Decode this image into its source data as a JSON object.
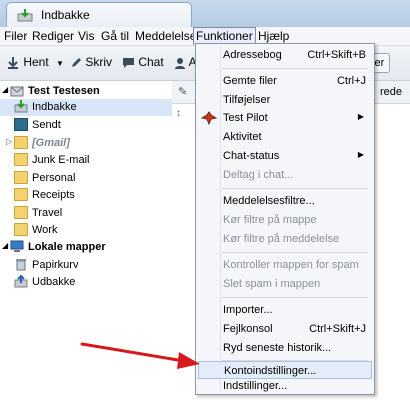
{
  "window": {
    "tab_title": "Indbakke"
  },
  "menubar": [
    "Filer",
    "Rediger",
    "Vis",
    "Gå til",
    "Meddelelse",
    "Funktioner",
    "Hjælp"
  ],
  "toolbar": {
    "get": "Hent",
    "write": "Skriv",
    "chat": "Chat",
    "partial": "A",
    "filter": "lter",
    "quick_filter_hint": "rede"
  },
  "folders": {
    "account1": "Test Testesen",
    "inbox": "Indbakke",
    "sent": "Sendt",
    "gmail": "[Gmail]",
    "junk": "Junk E-mail",
    "personal": "Personal",
    "receipts": "Receipts",
    "travel": "Travel",
    "work": "Work",
    "local": "Lokale mapper",
    "trash": "Papirkurv",
    "outbox": "Udbakke"
  },
  "menu": {
    "addressbook": {
      "label": "Adressebog",
      "shortcut": "Ctrl+Skift+B"
    },
    "saved_files": {
      "label": "Gemte filer",
      "shortcut": "Ctrl+J"
    },
    "addons": {
      "label": "Tilføjelser"
    },
    "test_pilot": {
      "label": "Test Pilot"
    },
    "activity": {
      "label": "Aktivitet"
    },
    "chat_status": {
      "label": "Chat-status"
    },
    "join_chat": {
      "label": "Deltag i chat..."
    },
    "message_filters": {
      "label": "Meddelelsesfiltre..."
    },
    "run_filters_folder": {
      "label": "Kør filtre på mappe"
    },
    "run_filters_message": {
      "label": "Kør filtre på meddelelse"
    },
    "check_spam": {
      "label": "Kontroller mappen for spam"
    },
    "delete_spam": {
      "label": "Slet spam i mappen"
    },
    "import": {
      "label": "Importer..."
    },
    "error_console": {
      "label": "Fejlkonsol",
      "shortcut": "Ctrl+Skift+J"
    },
    "clear_history": {
      "label": "Ryd seneste historik..."
    },
    "account_settings": {
      "label": "Kontoindstillinger..."
    },
    "settings": {
      "label": "Indstillinger..."
    }
  },
  "colors": {
    "arrow": "#d7191c",
    "highlight": "#e3ecf8"
  }
}
